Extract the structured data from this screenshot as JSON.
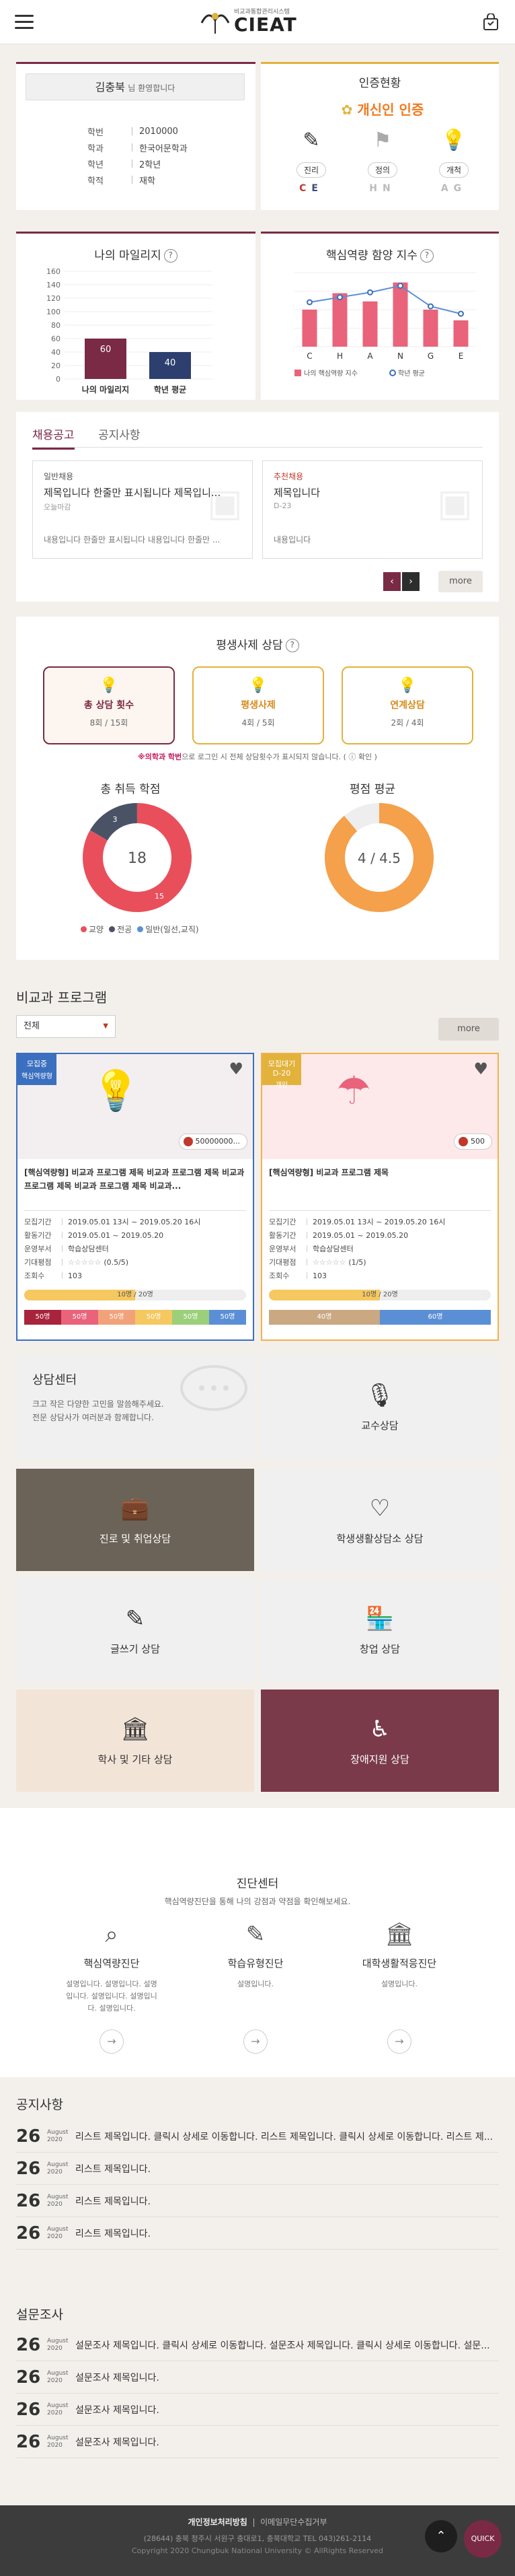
{
  "header": {
    "logo_sub": "비교과통합관리시스템",
    "logo_main": "CIEAT",
    "menu_icon": "menu-icon",
    "cart_icon": "bag-icon"
  },
  "profile": {
    "name": "김충북",
    "greeting": "님 환영합니다",
    "rows": [
      {
        "k": "학번",
        "v": "2010000"
      },
      {
        "k": "학과",
        "v": "한국어문학과"
      },
      {
        "k": "학년",
        "v": "2학년"
      },
      {
        "k": "학적",
        "v": "재학"
      }
    ]
  },
  "cert": {
    "title": "인증현황",
    "badge": "개신인 인증",
    "items": [
      {
        "label": "진리",
        "letters": [
          "C",
          "E"
        ],
        "active": true
      },
      {
        "label": "정의",
        "letters": [
          "H",
          "N"
        ],
        "active": false
      },
      {
        "label": "개척",
        "letters": [
          "A",
          "G"
        ],
        "active": false
      }
    ]
  },
  "mileage": {
    "title": "나의 마일리지",
    "help": "?",
    "y_ticks": [
      "160",
      "140",
      "120",
      "100",
      "80",
      "60",
      "40",
      "20",
      "0"
    ]
  },
  "core": {
    "title": "핵심역량 함양 지수",
    "help": "?",
    "letters": [
      "C",
      "H",
      "A",
      "N",
      "G",
      "E"
    ],
    "legend_bar": "나의 핵심역량 지수",
    "legend_line": "학년 평균"
  },
  "chart_data": [
    {
      "type": "bar",
      "categories": [
        "나의 마일리지",
        "학년 평균"
      ],
      "values": [
        60,
        40
      ],
      "ylim": [
        0,
        160
      ],
      "colors": [
        "#7a2a44",
        "#2d3f6e"
      ]
    },
    {
      "type": "bar",
      "categories": [
        "C",
        "H",
        "A",
        "N",
        "G",
        "E"
      ],
      "series": [
        {
          "name": "나의 핵심역량 지수",
          "values": [
            4.5,
            6.5,
            5.5,
            7.8,
            4.5,
            3.2
          ]
        },
        {
          "name": "학년 평균",
          "values": [
            5.4,
            6.0,
            6.6,
            7.4,
            4.9,
            4.0
          ]
        }
      ],
      "ylim": [
        0,
        9
      ]
    }
  ],
  "jobs": {
    "tabs": [
      "채용공고",
      "공지사항"
    ],
    "cards": [
      {
        "tag": "일반채용",
        "title": "제목입니다 한줄만 표시됩니다 제목입니...",
        "meta": "오늘마감",
        "body": "내용입니다 한줄만 표시됩니다 내용입니다 한줄만 ..."
      },
      {
        "tag": "추천채용",
        "title": "제목입니다",
        "meta": "D-23",
        "body": "내용입니다"
      }
    ],
    "more": "more"
  },
  "counsel": {
    "title": "평생사제 상담",
    "help": "?",
    "boxes": [
      {
        "label": "총 상담 횟수",
        "value": "8회 / 15회"
      },
      {
        "label": "평생사제",
        "value": "4회 / 5회"
      },
      {
        "label": "연계상담",
        "value": "2회 / 4회"
      }
    ],
    "note_bold": "※의학과 학번",
    "note": "으로 로그인 시 전체 상담횟수가 표시되지 않습니다.",
    "note_link": "( ⓘ 확인 )"
  },
  "credits": {
    "title": "총 취득 학점",
    "center": "18",
    "segs": [
      {
        "label": "교양",
        "value": 15,
        "color": "#e94f5b"
      },
      {
        "label": "전공",
        "value": 3,
        "color": "#4a5366"
      },
      {
        "label": "일반(일선,교직)",
        "value": 0,
        "color": "#5a8fd6"
      }
    ]
  },
  "gpa": {
    "title": "평점 평균",
    "center": "4 / 4.5",
    "value": 4,
    "max": 4.5
  },
  "programs": {
    "title": "비교과 프로그램",
    "filter": "전체",
    "more": "more",
    "cards": [
      {
        "flag": "모집중",
        "tag": "핵심역량형",
        "points": "50000000...",
        "title": "[핵심역량형] 비교과 프로그램 제목 비교과 프로그램 제목 비교과 프로그램 제목 비교과 프로그램 제목 비교과...",
        "rows": [
          {
            "k": "모집기간",
            "v": "2019.05.01 13시 ~ 2019.05.20 16시"
          },
          {
            "k": "활동기간",
            "v": "2019.05.01 ~ 2019.05.20"
          },
          {
            "k": "운영부서",
            "v": "학습상담센터"
          },
          {
            "k": "기대평점",
            "v": "(0.5/5)"
          },
          {
            "k": "조회수",
            "v": "103"
          }
        ],
        "progress": "10명 / 20명",
        "stack": [
          "50명",
          "50명",
          "50명",
          "50명",
          "50명",
          "50명"
        ]
      },
      {
        "flag": "모집대기",
        "sub": "D-20",
        "tag": "개인",
        "points": "500",
        "title": "[핵심역량형] 비교과 프로그램 제목",
        "rows": [
          {
            "k": "모집기간",
            "v": "2019.05.01 13시 ~ 2019.05.20 16시"
          },
          {
            "k": "활동기간",
            "v": "2019.05.01 ~ 2019.05.20"
          },
          {
            "k": "운영부서",
            "v": "학습상담센터"
          },
          {
            "k": "기대평점",
            "v": "(1/5)"
          },
          {
            "k": "조회수",
            "v": "103"
          }
        ],
        "progress": "10명 / 20명",
        "stack": [
          "40명",
          "60명"
        ]
      }
    ]
  },
  "center": {
    "title": "상담센터",
    "desc": "크고 작은 다양한 고민을 말씀해주세요. 전문 상담사가 여러분과 함께합니다.",
    "tiles": [
      "교수상담",
      "진로 및 취업상담",
      "학생생활상담소 상담",
      "글쓰기 상담",
      "창업 상담",
      "학사 및 기타 상담",
      "장애지원 상담"
    ]
  },
  "diag": {
    "title": "진단센터",
    "desc": "핵심역량진단을 통해 나의 강점과 약점을 확인해보세요.",
    "items": [
      {
        "title": "핵심역량진단",
        "desc": "설명입니다. 설명입니다. 설명입니다. 설명입니다. 설명입니다. 설명입니다."
      },
      {
        "title": "학습유형진단",
        "desc": "설명입니다."
      },
      {
        "title": "대학생활적응진단",
        "desc": "설명입니다."
      }
    ]
  },
  "notice": {
    "title": "공지사항",
    "rows": [
      {
        "d": "26",
        "m": "August",
        "y": "2020",
        "t": "리스트 제목입니다. 클릭시 상세로 이동합니다. 리스트 제목입니다. 클릭시 상세로 이동합니다. 리스트 제..."
      },
      {
        "d": "26",
        "m": "August",
        "y": "2020",
        "t": "리스트 제목입니다."
      },
      {
        "d": "26",
        "m": "August",
        "y": "2020",
        "t": "리스트 제목입니다."
      },
      {
        "d": "26",
        "m": "August",
        "y": "2020",
        "t": "리스트 제목입니다."
      }
    ]
  },
  "survey": {
    "title": "설문조사",
    "rows": [
      {
        "d": "26",
        "m": "August",
        "y": "2020",
        "t": "설문조사 제목입니다. 클릭시 상세로 이동합니다. 설문조사 제목입니다. 클릭시 상세로 이동합니다. 설문..."
      },
      {
        "d": "26",
        "m": "August",
        "y": "2020",
        "t": "설문조사 제목입니다."
      },
      {
        "d": "26",
        "m": "August",
        "y": "2020",
        "t": "설문조사 제목입니다."
      },
      {
        "d": "26",
        "m": "August",
        "y": "2020",
        "t": "설문조사 제목입니다."
      }
    ]
  },
  "footer": {
    "link1": "개인정보처리방침",
    "link2": "이메일무단수집거부",
    "addr": "(28644) 충북 청주시 서원구 충대로1, 충북대학교 TEL 043)261-2114",
    "copy": "Copyright 2020 Chungbuk National University © AllRights Reserved",
    "top": "TOP",
    "quick": "QUICK"
  }
}
